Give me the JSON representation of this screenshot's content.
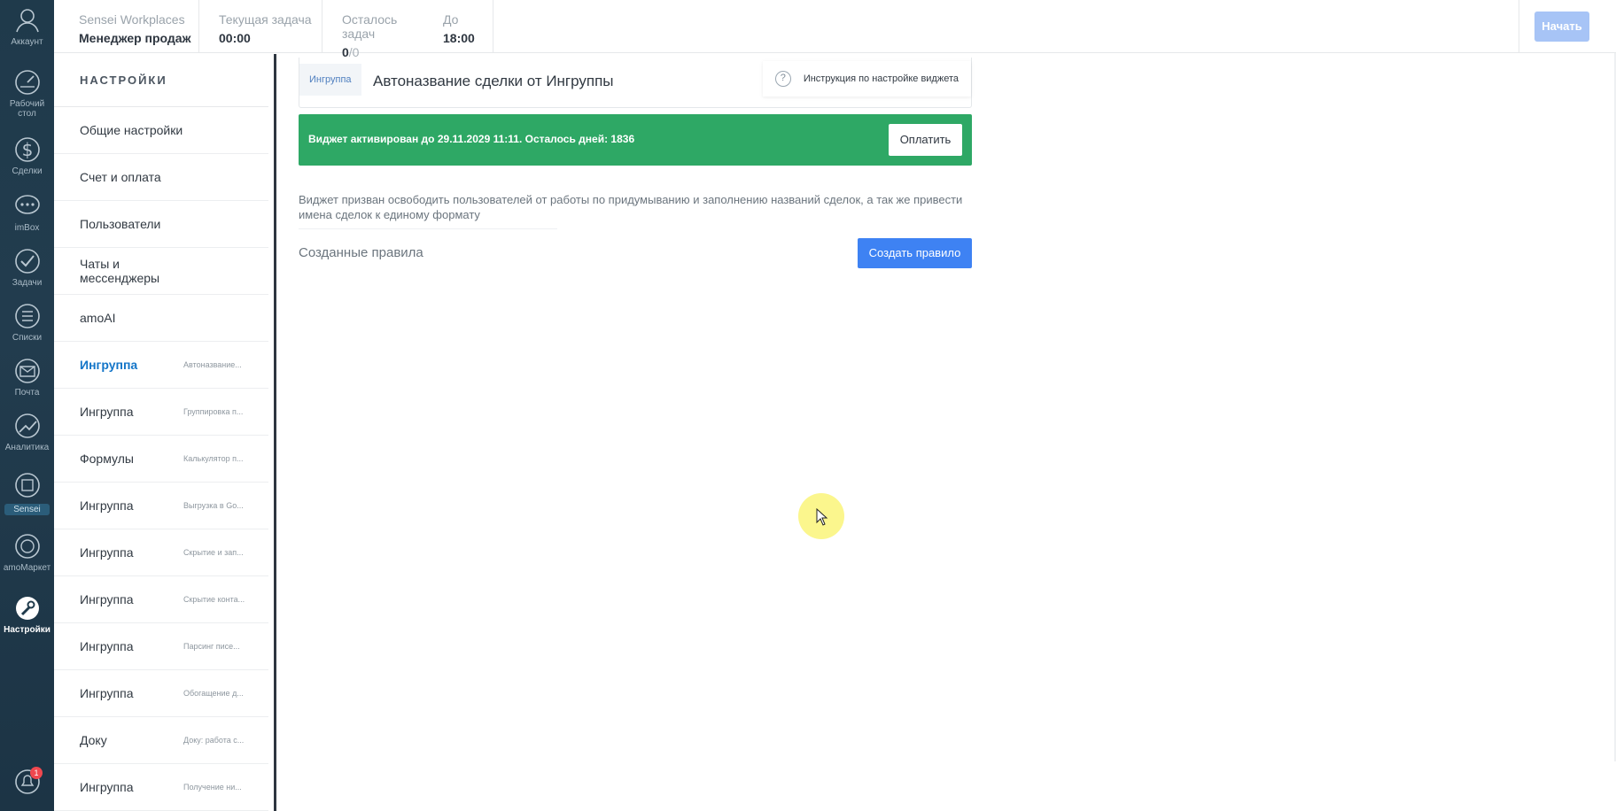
{
  "rail": {
    "account": "Аккаунт",
    "desktop": "Рабочий стол",
    "deals": "Сделки",
    "imbox": "imBox",
    "tasks": "Задачи",
    "lists": "Списки",
    "mail": "Почта",
    "analytics": "Аналитика",
    "sensei": "Sensei",
    "amomarket": "amoМаркет",
    "settings": "Настройки",
    "notifications_count": "1"
  },
  "topbar": {
    "workspace_title": "Sensei Workplaces",
    "workspace_role": "Менеджер продаж",
    "current_task_label": "Текущая задача",
    "current_task_value": "00:00",
    "tasks_left_label": "Осталось задач",
    "tasks_left_done": "0",
    "tasks_left_total": "/0",
    "until_label": "До",
    "until_value": "18:00",
    "start_button": "Начать"
  },
  "settings_nav": {
    "title": "НАСТРОЙКИ",
    "items": [
      {
        "label": "Общие настройки",
        "sub": ""
      },
      {
        "label": "Счет и оплата",
        "sub": ""
      },
      {
        "label": "Пользователи",
        "sub": ""
      },
      {
        "label": "Чаты и мессенджеры",
        "sub": ""
      },
      {
        "label": "amoAI",
        "sub": ""
      },
      {
        "label": "Ингруппа",
        "sub": "Автоназвание..."
      },
      {
        "label": "Ингруппа",
        "sub": "Группировка п..."
      },
      {
        "label": "Формулы",
        "sub": "Калькулятор п..."
      },
      {
        "label": "Ингруппа",
        "sub": "Выгрузка в Go..."
      },
      {
        "label": "Ингруппа",
        "sub": "Скрытие и зап..."
      },
      {
        "label": "Ингруппа",
        "sub": "Скрытие конта..."
      },
      {
        "label": "Ингруппа",
        "sub": "Парсинг писе..."
      },
      {
        "label": "Ингруппа",
        "sub": "Обогащение д..."
      },
      {
        "label": "Доку",
        "sub": "Доку: работа с..."
      },
      {
        "label": "Ингруппа",
        "sub": "Получение ни..."
      }
    ]
  },
  "widget": {
    "vendor_tag": "Ингруппа",
    "title": "Автоназвание сделки от Ингруппы",
    "help_link": "Инструкция по настройке виджета",
    "banner_text": "Виджет активирован до 29.11.2029 11:11. Осталось дней: 1836",
    "pay_button": "Оплатить",
    "description": "Виджет призван освободить пользователей от работы по придумыванию и заполнению названий сделок, а так же привести имена сделок к единому формату",
    "rules_label": "Созданные правила",
    "create_rule_button": "Создать правило"
  },
  "colors": {
    "rail_bg": "#1f3a4b",
    "banner_green": "#2ea865",
    "primary_blue": "#3e82f3",
    "active_link": "#1375c8"
  }
}
